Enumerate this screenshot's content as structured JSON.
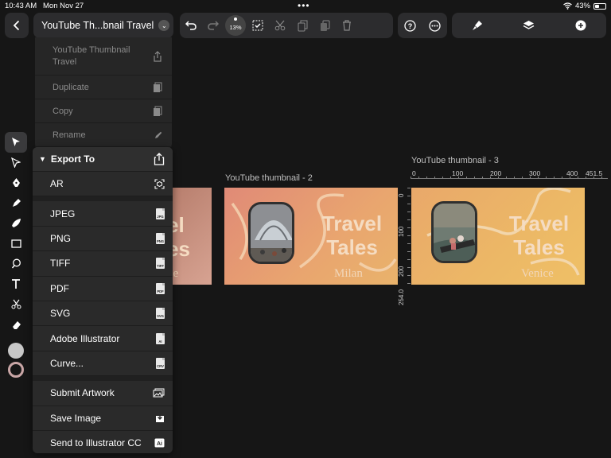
{
  "status_bar": {
    "time": "10:43 AM",
    "date": "Mon Nov 27",
    "battery": "43%",
    "battery_level": 0.43
  },
  "toolbar": {
    "document_title": "YouTube Th...bnail Travel",
    "zoom": "13%"
  },
  "file_menu": {
    "items": [
      {
        "label": "YouTube Thumbnail Travel",
        "icon": "share-icon"
      },
      {
        "label": "Duplicate",
        "icon": "duplicate-icon"
      },
      {
        "label": "Copy",
        "icon": "copy-icon"
      },
      {
        "label": "Rename",
        "icon": "pencil-icon"
      }
    ]
  },
  "export_menu": {
    "header": "Export To",
    "ar": "AR",
    "formats": [
      {
        "label": "JPEG",
        "badge": "JPG"
      },
      {
        "label": "PNG",
        "badge": "PNG"
      },
      {
        "label": "TIFF",
        "badge": "TIFF"
      },
      {
        "label": "PDF",
        "badge": "PDF"
      },
      {
        "label": "SVG",
        "badge": "SVG"
      },
      {
        "label": "Adobe Illustrator",
        "badge": "AI"
      },
      {
        "label": "Curve...",
        "badge": "CRV"
      }
    ],
    "actions": [
      {
        "label": "Submit Artwork",
        "icon": "image-icon"
      },
      {
        "label": "Save Image",
        "icon": "save-icon"
      },
      {
        "label": "Send to Illustrator CC",
        "icon": "ai-icon"
      }
    ]
  },
  "canvas": {
    "artboard0": {
      "partial_text_1": "el",
      "partial_text_2": "es",
      "partial_text_3": "ne"
    },
    "artboard2": {
      "label": "YouTube thumbnail - 2",
      "title_1": "Travel",
      "title_2": "Tales",
      "subtitle": "Milan"
    },
    "artboard3": {
      "label": "YouTube thumbnail - 3",
      "title_1": "Travel",
      "title_2": "Tales",
      "subtitle": "Venice"
    },
    "h_ruler": [
      "0",
      "100",
      "200",
      "300",
      "400",
      "451.5"
    ],
    "v_ruler": [
      "0",
      "100",
      "200",
      "254.0"
    ]
  },
  "colors": {
    "accent_text": "#f5dcc2",
    "menu_bg": "#2a2a2a",
    "toolbar_bg": "#2c2c2e"
  }
}
